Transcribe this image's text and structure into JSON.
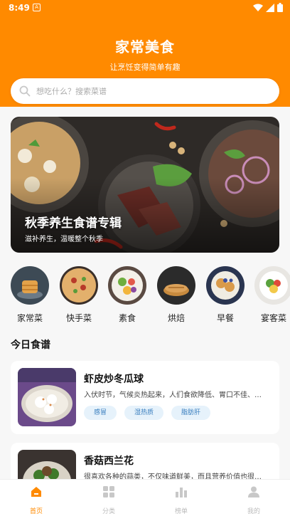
{
  "status_bar": {
    "time": "8:49",
    "notif_glyph": "A"
  },
  "header": {
    "title": "家常美食",
    "subtitle": "让烹饪变得简单有趣",
    "bg_color": "#ff8a00"
  },
  "search": {
    "placeholder": "想吃什么？搜索菜谱"
  },
  "banner": {
    "title": "秋季养生食谱专辑",
    "subtitle": "滋补养生，温暖整个秋季"
  },
  "categories": [
    {
      "label": "家常菜"
    },
    {
      "label": "快手菜"
    },
    {
      "label": "素食"
    },
    {
      "label": "烘焙"
    },
    {
      "label": "早餐"
    },
    {
      "label": "宴客菜"
    }
  ],
  "section": {
    "title": "今日食谱"
  },
  "recipes": [
    {
      "title": "虾皮炒冬瓜球",
      "desc": "入伏时节，气候炎热起来，人们食欲降低、胃口不佳、…",
      "tags": [
        "感冒",
        "湿热质",
        "脂肪肝"
      ]
    },
    {
      "title": "香菇西兰花",
      "desc": "很喜欢各种的蒜类，不仅味道鲜美，而且营养价值也很…",
      "tags": []
    }
  ],
  "tabs": [
    {
      "label": "首页",
      "icon": "home-icon",
      "active": true
    },
    {
      "label": "分类",
      "icon": "grid-icon",
      "active": false
    },
    {
      "label": "榜单",
      "icon": "chart-icon",
      "active": false
    },
    {
      "label": "我的",
      "icon": "user-icon",
      "active": false
    }
  ],
  "colors": {
    "accent": "#ff8a00",
    "tag_bg": "#e6f2fb",
    "tag_text": "#3a7fbf",
    "inactive_tab": "#bbbbbb"
  }
}
